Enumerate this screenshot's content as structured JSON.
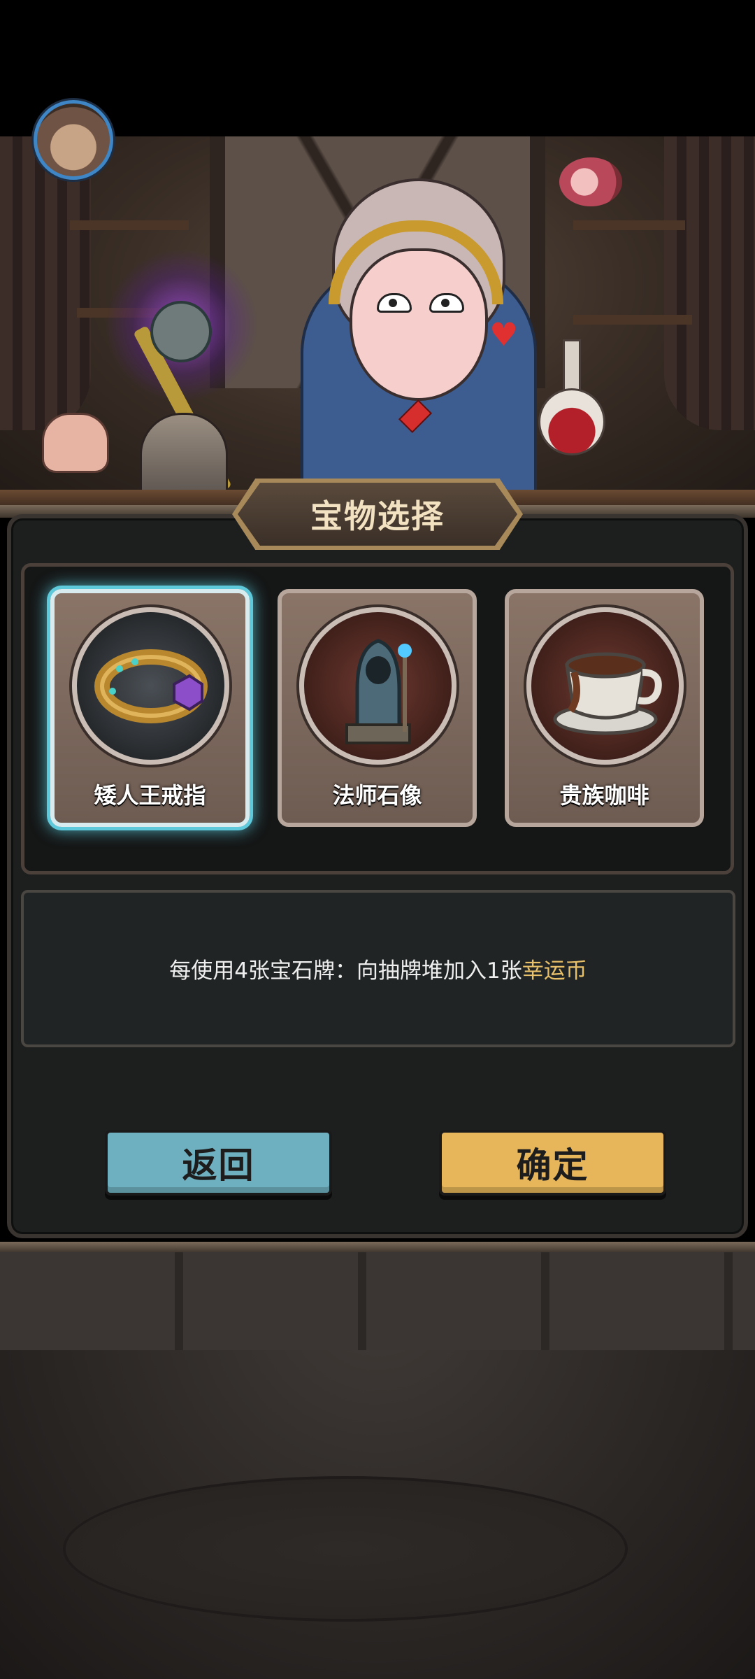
{
  "header": {
    "avatar_icon": "player-portrait-icon"
  },
  "dialog": {
    "title": "宝物选择",
    "options": [
      {
        "name": "矮人王戒指",
        "icon": "ring-icon",
        "selected": true
      },
      {
        "name": "法师石像",
        "icon": "mage-statue-icon",
        "selected": false
      },
      {
        "name": "贵族咖啡",
        "icon": "coffee-cup-icon",
        "selected": false
      }
    ],
    "description": {
      "prefix": "每使用4张宝石牌：向抽牌堆加入1张",
      "highlight": "幸运币"
    },
    "buttons": {
      "back_label": "返回",
      "confirm_label": "确定"
    }
  },
  "colors": {
    "selected_glow": "#5fc9dc",
    "highlight_text": "#e8c06a",
    "back_button": "#6fb0c0",
    "confirm_button": "#e7b65a"
  }
}
